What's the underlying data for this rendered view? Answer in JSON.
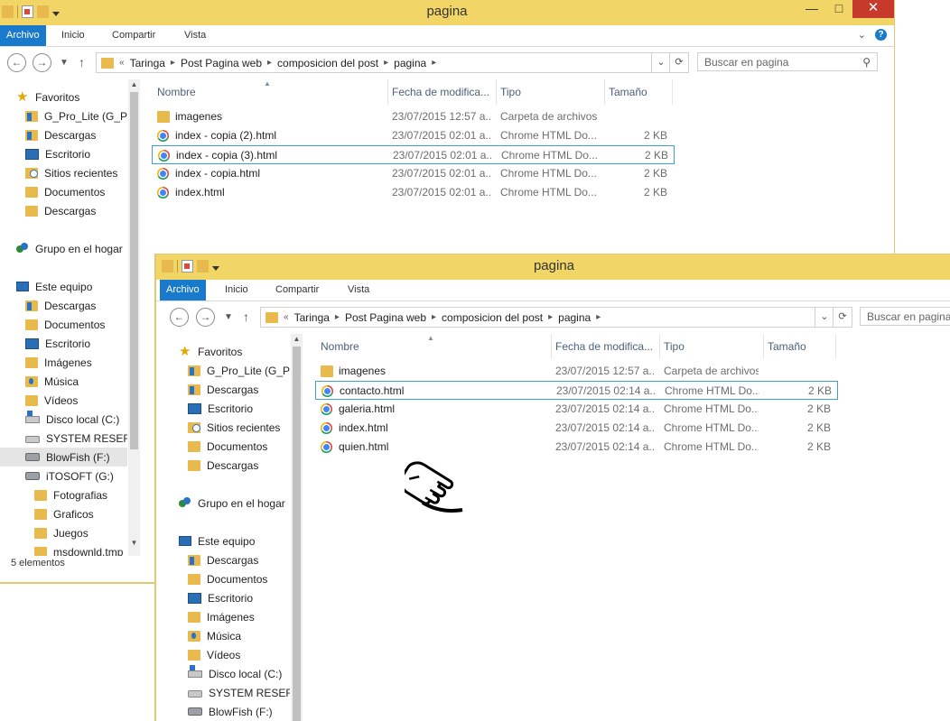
{
  "window_back": {
    "title": "pagina",
    "ribbon_tabs": [
      "Archivo",
      "Inicio",
      "Compartir",
      "Vista"
    ],
    "window_controls": {
      "minimize": "—",
      "maximize": "□",
      "close": "✕"
    },
    "help": "?",
    "address": {
      "prefix": "«",
      "segments": [
        "Taringa",
        "Post Pagina web",
        "composicion del post",
        "pagina"
      ]
    },
    "search_placeholder": "Buscar en pagina",
    "nav_items": [
      {
        "label": "Favoritos",
        "icon": "star-icon"
      },
      {
        "label": "G_Pro_Lite (G_Pro",
        "icon": "folder-download-icon"
      },
      {
        "label": "Descargas",
        "icon": "folder-download-icon"
      },
      {
        "label": "Escritorio",
        "icon": "desktop-icon"
      },
      {
        "label": "Sitios recientes",
        "icon": "recent-places-icon"
      },
      {
        "label": "Documentos",
        "icon": "folder-icon"
      },
      {
        "label": "Descargas",
        "icon": "folder-icon"
      },
      {
        "label": "Grupo en el hogar",
        "icon": "homegroup-icon"
      },
      {
        "label": "Este equipo",
        "icon": "this-pc-icon"
      },
      {
        "label": "Descargas",
        "icon": "folder-download-icon"
      },
      {
        "label": "Documentos",
        "icon": "folder-icon"
      },
      {
        "label": "Escritorio",
        "icon": "desktop-icon"
      },
      {
        "label": "Imágenes",
        "icon": "folder-icon"
      },
      {
        "label": "Música",
        "icon": "folder-music-icon"
      },
      {
        "label": "Vídeos",
        "icon": "folder-icon"
      },
      {
        "label": "Disco local (C:)",
        "icon": "os-drive-icon"
      },
      {
        "label": "SYSTEM RESERVE",
        "icon": "drive-icon"
      },
      {
        "label": "BlowFish (F:)",
        "icon": "usb-drive-icon"
      },
      {
        "label": "iTOSOFT (G:)",
        "icon": "usb-drive-icon"
      },
      {
        "label": "Fotografias",
        "icon": "folder-icon"
      },
      {
        "label": "Graficos",
        "icon": "folder-icon"
      },
      {
        "label": "Juegos",
        "icon": "folder-icon"
      },
      {
        "label": "msdownld.tmp",
        "icon": "folder-icon"
      }
    ],
    "columns": [
      "Nombre",
      "Fecha de modifica...",
      "Tipo",
      "Tamaño"
    ],
    "files": [
      {
        "name": "imagenes",
        "date": "23/07/2015 12:57 a...",
        "type": "Carpeta de archivos",
        "size": "",
        "icon": "folder-icon"
      },
      {
        "name": "index - copia (2).html",
        "date": "23/07/2015 02:01 a...",
        "type": "Chrome HTML Do...",
        "size": "2 KB",
        "icon": "chrome-icon"
      },
      {
        "name": "index - copia (3).html",
        "date": "23/07/2015 02:01 a...",
        "type": "Chrome HTML Do...",
        "size": "2 KB",
        "icon": "chrome-icon"
      },
      {
        "name": "index - copia.html",
        "date": "23/07/2015 02:01 a...",
        "type": "Chrome HTML Do...",
        "size": "2 KB",
        "icon": "chrome-icon"
      },
      {
        "name": "index.html",
        "date": "23/07/2015 02:01 a...",
        "type": "Chrome HTML Do...",
        "size": "2 KB",
        "icon": "chrome-icon"
      }
    ],
    "status": "5 elementos"
  },
  "window_front": {
    "title": "pagina",
    "ribbon_tabs": [
      "Archivo",
      "Inicio",
      "Compartir",
      "Vista"
    ],
    "address": {
      "prefix": "«",
      "segments": [
        "Taringa",
        "Post Pagina web",
        "composicion del post",
        "pagina"
      ]
    },
    "search_placeholder": "Buscar en pagina",
    "nav_items": [
      {
        "label": "Favoritos",
        "icon": "star-icon"
      },
      {
        "label": "G_Pro_Lite (G_Pro",
        "icon": "folder-download-icon"
      },
      {
        "label": "Descargas",
        "icon": "folder-download-icon"
      },
      {
        "label": "Escritorio",
        "icon": "desktop-icon"
      },
      {
        "label": "Sitios recientes",
        "icon": "recent-places-icon"
      },
      {
        "label": "Documentos",
        "icon": "folder-icon"
      },
      {
        "label": "Descargas",
        "icon": "folder-icon"
      },
      {
        "label": "Grupo en el hogar",
        "icon": "homegroup-icon"
      },
      {
        "label": "Este equipo",
        "icon": "this-pc-icon"
      },
      {
        "label": "Descargas",
        "icon": "folder-download-icon"
      },
      {
        "label": "Documentos",
        "icon": "folder-icon"
      },
      {
        "label": "Escritorio",
        "icon": "desktop-icon"
      },
      {
        "label": "Imágenes",
        "icon": "folder-icon"
      },
      {
        "label": "Música",
        "icon": "folder-music-icon"
      },
      {
        "label": "Vídeos",
        "icon": "folder-icon"
      },
      {
        "label": "Disco local (C:)",
        "icon": "os-drive-icon"
      },
      {
        "label": "SYSTEM RESERVE",
        "icon": "drive-icon"
      },
      {
        "label": "BlowFish (F:)",
        "icon": "usb-drive-icon"
      }
    ],
    "columns": [
      "Nombre",
      "Fecha de modifica...",
      "Tipo",
      "Tamaño"
    ],
    "files": [
      {
        "name": "imagenes",
        "date": "23/07/2015 12:57 a...",
        "type": "Carpeta de archivos",
        "size": "",
        "icon": "folder-icon"
      },
      {
        "name": "contacto.html",
        "date": "23/07/2015 02:14 a...",
        "type": "Chrome HTML Do...",
        "size": "2 KB",
        "icon": "chrome-icon"
      },
      {
        "name": "galeria.html",
        "date": "23/07/2015 02:14 a...",
        "type": "Chrome HTML Do...",
        "size": "2 KB",
        "icon": "chrome-icon"
      },
      {
        "name": "index.html",
        "date": "23/07/2015 02:14 a...",
        "type": "Chrome HTML Do...",
        "size": "2 KB",
        "icon": "chrome-icon"
      },
      {
        "name": "quien.html",
        "date": "23/07/2015 02:14 a...",
        "type": "Chrome HTML Do...",
        "size": "2 KB",
        "icon": "chrome-icon"
      }
    ]
  },
  "cursor": {
    "icon": "hand-pointer-cursor-icon"
  },
  "colors": {
    "titlebar": "#f2d567",
    "file_tab": "#1979ca",
    "close": "#c7392b",
    "selection_border": "#3d9fd6"
  }
}
